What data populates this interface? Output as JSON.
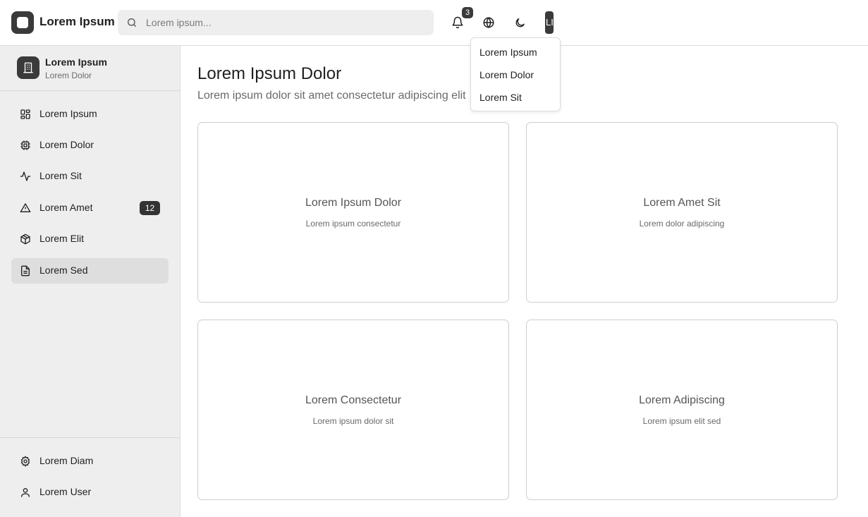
{
  "header": {
    "app_title": "Lorem Ipsum",
    "search_placeholder": "Lorem ipsum...",
    "notification_count": "3",
    "avatar_initials": "LI"
  },
  "user_menu": {
    "items": [
      {
        "label": "Lorem Ipsum"
      },
      {
        "label": "Lorem Dolor"
      },
      {
        "label": "Lorem Sit"
      }
    ]
  },
  "sidebar": {
    "org_name": "Lorem Ipsum",
    "org_sub": "Lorem Dolor",
    "items": [
      {
        "label": "Lorem Ipsum",
        "icon": "dashboard-icon"
      },
      {
        "label": "Lorem Dolor",
        "icon": "cpu-icon"
      },
      {
        "label": "Lorem Sit",
        "icon": "activity-icon"
      },
      {
        "label": "Lorem Amet",
        "icon": "alert-triangle-icon",
        "badge": "12"
      },
      {
        "label": "Lorem Elit",
        "icon": "package-icon"
      },
      {
        "label": "Lorem Sed",
        "icon": "document-icon",
        "active": true
      }
    ],
    "bottom_items": [
      {
        "label": "Lorem Diam",
        "icon": "gear-icon"
      },
      {
        "label": "Lorem User",
        "icon": "user-icon"
      }
    ]
  },
  "main": {
    "title": "Lorem Ipsum Dolor",
    "subtitle": "Lorem ipsum dolor sit amet consectetur adipiscing elit",
    "cards": [
      {
        "title": "Lorem Ipsum Dolor",
        "subtitle": "Lorem ipsum consectetur"
      },
      {
        "title": "Lorem Amet Sit",
        "subtitle": "Lorem dolor adipiscing"
      },
      {
        "title": "Lorem Consectetur",
        "subtitle": "Lorem ipsum dolor sit"
      },
      {
        "title": "Lorem Adipiscing",
        "subtitle": "Lorem ipsum elit sed"
      }
    ]
  },
  "colors": {
    "accent": "#3a3a3a",
    "sidebar_bg": "#eeeeee",
    "active_item_bg": "#dedede",
    "border": "#dcdcdc"
  }
}
